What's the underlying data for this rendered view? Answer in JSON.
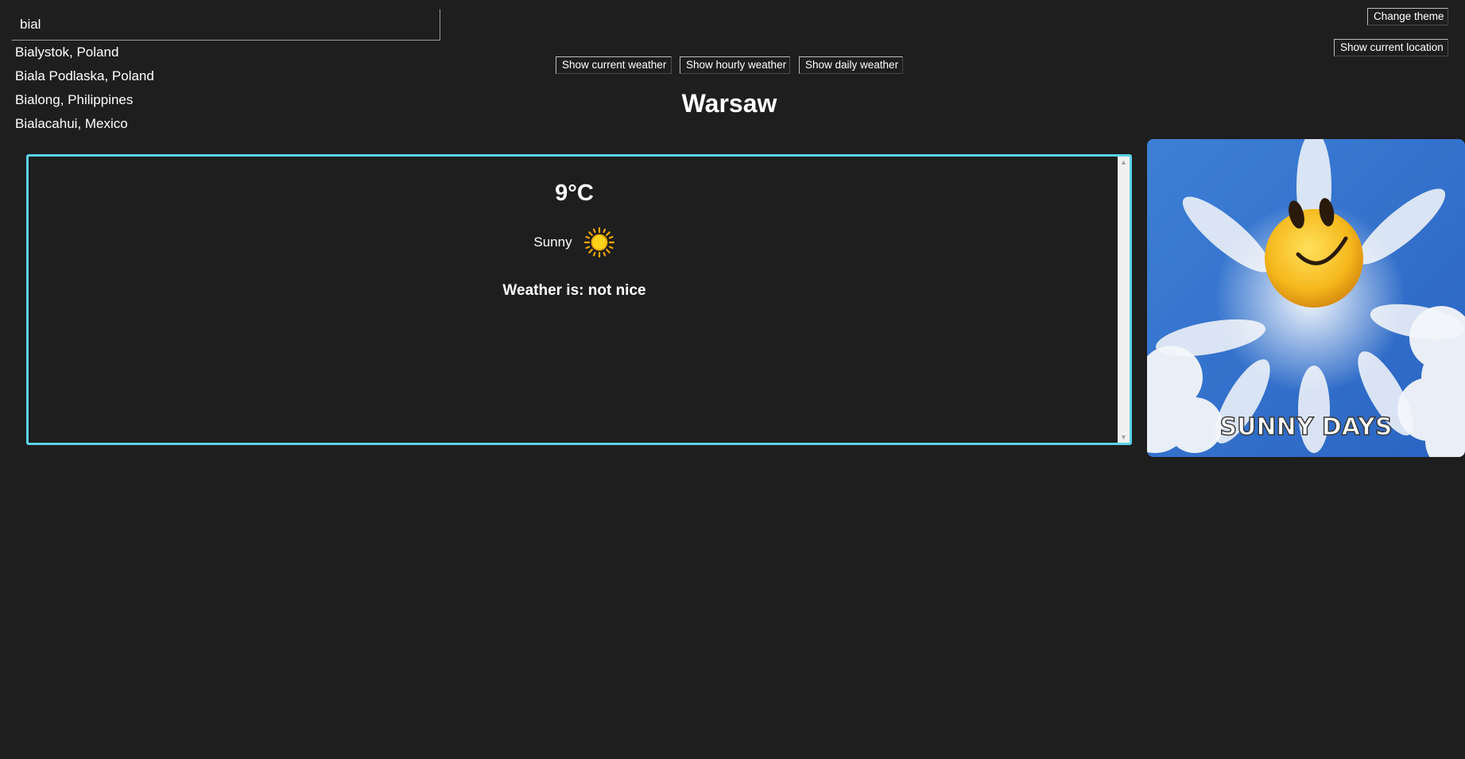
{
  "search": {
    "value": "bial",
    "suggestions": [
      "Bialystok, Poland",
      "Biala Podlaska, Poland",
      "Bialong, Philippines",
      "Bialacahui, Mexico"
    ]
  },
  "buttons": {
    "change_theme": "Change theme",
    "show_current_location": "Show current location",
    "show_current_weather": "Show current weather",
    "show_hourly_weather": "Show hourly weather",
    "show_daily_weather": "Show daily weather"
  },
  "city": "Warsaw",
  "weather": {
    "temperature": "9°C",
    "condition": "Sunny",
    "condition_icon": "sun-icon",
    "verdict": "Weather is: not nice"
  },
  "image": {
    "caption": "SUNNY DAYS"
  },
  "colors": {
    "background": "#1e1e1e",
    "panel_border": "#5bd3e8",
    "sun": "#ffcc00"
  }
}
